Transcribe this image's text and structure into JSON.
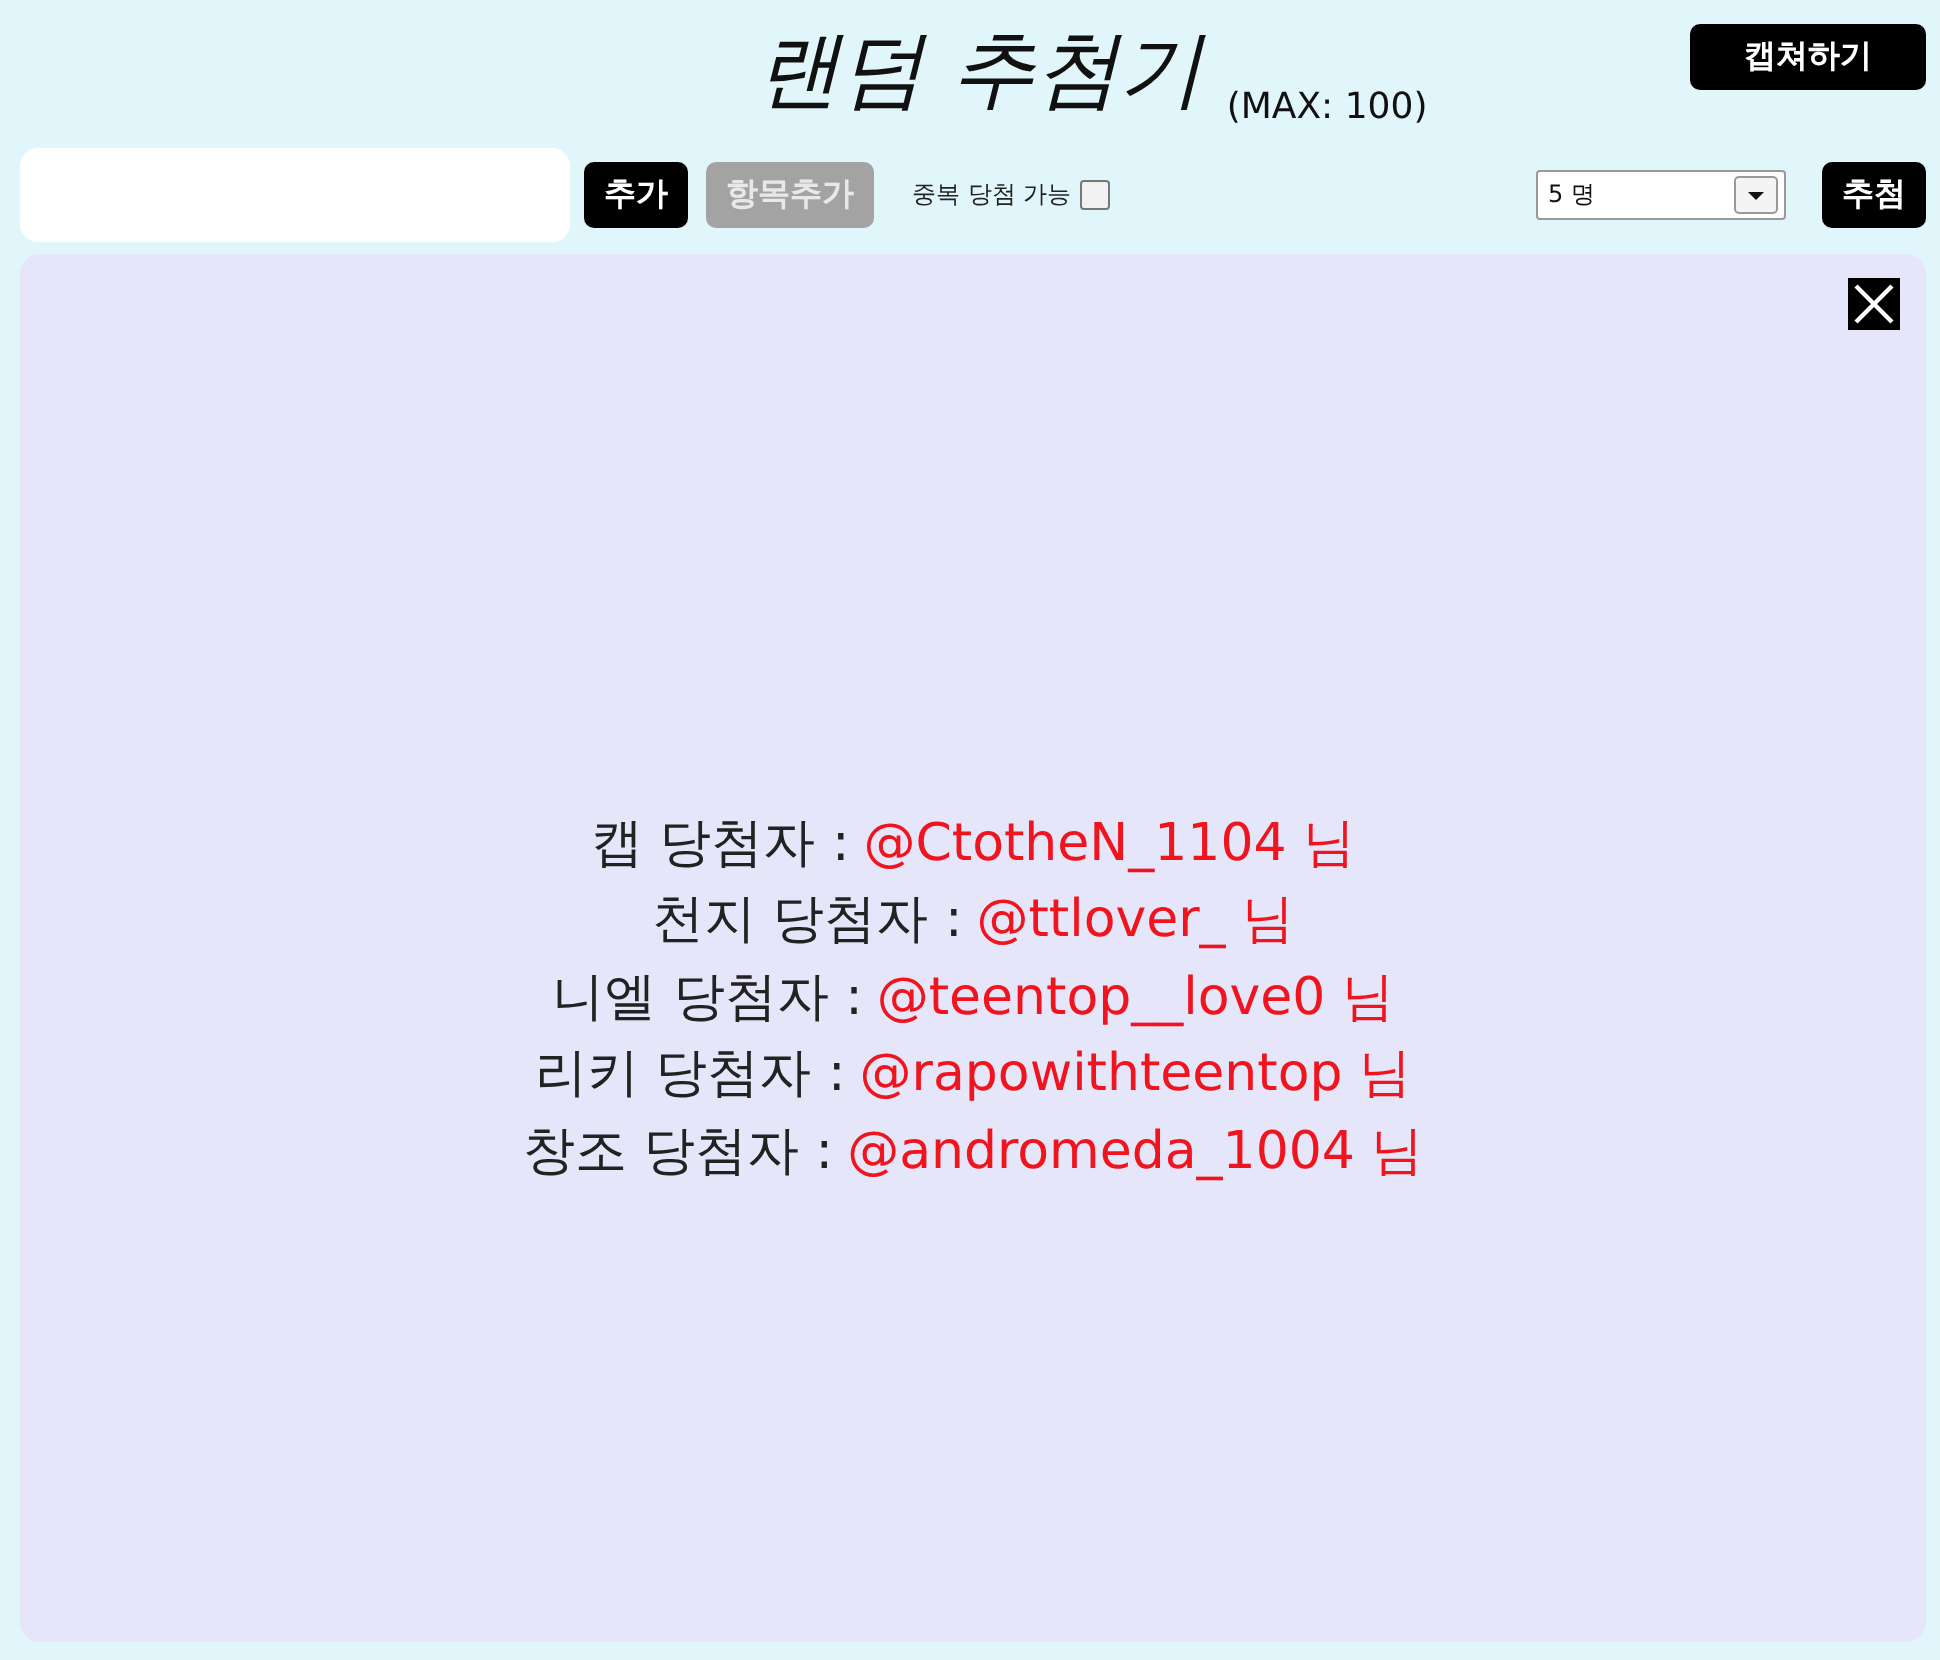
{
  "header": {
    "title": "랜덤 추첨기",
    "limit": "(MAX: 100)",
    "capture_button": "캡쳐하기"
  },
  "toolbar": {
    "add_button": {
      "label": "추가",
      "disabled": false
    },
    "add_items_button": {
      "label": "항목추가",
      "disabled": true
    },
    "duplicate_option": {
      "label": "중복 당첨 가능",
      "checked": false
    },
    "count_select": {
      "value": "5 명"
    },
    "draw_button": {
      "label": "추첨",
      "disabled": false
    }
  },
  "result_panel": {
    "winners": [
      {
        "label": "캡 당첨자 :",
        "handle": "@CtotheN_1104 님"
      },
      {
        "label": "천지 당첨자 :",
        "handle": "@ttlover_ 님"
      },
      {
        "label": "니엘 당첨자 :",
        "handle": "@teentop__love0 님"
      },
      {
        "label": "리키 당첨자 :",
        "handle": "@rapowithteentop 님"
      },
      {
        "label": "창조 당첨자 :",
        "handle": "@andromeda_1004 님"
      }
    ]
  }
}
